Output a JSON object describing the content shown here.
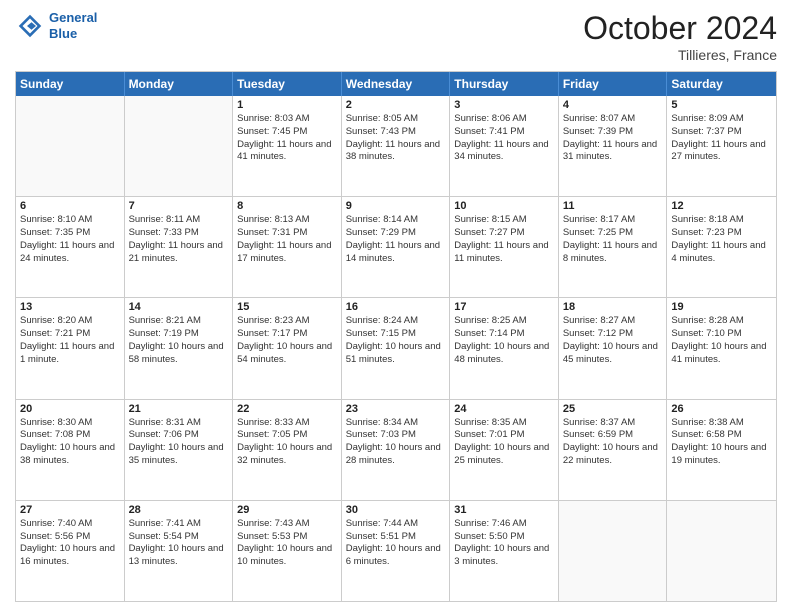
{
  "header": {
    "logo_line1": "General",
    "logo_line2": "Blue",
    "month": "October 2024",
    "location": "Tillieres, France"
  },
  "weekdays": [
    "Sunday",
    "Monday",
    "Tuesday",
    "Wednesday",
    "Thursday",
    "Friday",
    "Saturday"
  ],
  "rows": [
    [
      {
        "day": "",
        "empty": true
      },
      {
        "day": "",
        "empty": true
      },
      {
        "day": "1",
        "sunrise": "Sunrise: 8:03 AM",
        "sunset": "Sunset: 7:45 PM",
        "daylight": "Daylight: 11 hours and 41 minutes."
      },
      {
        "day": "2",
        "sunrise": "Sunrise: 8:05 AM",
        "sunset": "Sunset: 7:43 PM",
        "daylight": "Daylight: 11 hours and 38 minutes."
      },
      {
        "day": "3",
        "sunrise": "Sunrise: 8:06 AM",
        "sunset": "Sunset: 7:41 PM",
        "daylight": "Daylight: 11 hours and 34 minutes."
      },
      {
        "day": "4",
        "sunrise": "Sunrise: 8:07 AM",
        "sunset": "Sunset: 7:39 PM",
        "daylight": "Daylight: 11 hours and 31 minutes."
      },
      {
        "day": "5",
        "sunrise": "Sunrise: 8:09 AM",
        "sunset": "Sunset: 7:37 PM",
        "daylight": "Daylight: 11 hours and 27 minutes."
      }
    ],
    [
      {
        "day": "6",
        "sunrise": "Sunrise: 8:10 AM",
        "sunset": "Sunset: 7:35 PM",
        "daylight": "Daylight: 11 hours and 24 minutes."
      },
      {
        "day": "7",
        "sunrise": "Sunrise: 8:11 AM",
        "sunset": "Sunset: 7:33 PM",
        "daylight": "Daylight: 11 hours and 21 minutes."
      },
      {
        "day": "8",
        "sunrise": "Sunrise: 8:13 AM",
        "sunset": "Sunset: 7:31 PM",
        "daylight": "Daylight: 11 hours and 17 minutes."
      },
      {
        "day": "9",
        "sunrise": "Sunrise: 8:14 AM",
        "sunset": "Sunset: 7:29 PM",
        "daylight": "Daylight: 11 hours and 14 minutes."
      },
      {
        "day": "10",
        "sunrise": "Sunrise: 8:15 AM",
        "sunset": "Sunset: 7:27 PM",
        "daylight": "Daylight: 11 hours and 11 minutes."
      },
      {
        "day": "11",
        "sunrise": "Sunrise: 8:17 AM",
        "sunset": "Sunset: 7:25 PM",
        "daylight": "Daylight: 11 hours and 8 minutes."
      },
      {
        "day": "12",
        "sunrise": "Sunrise: 8:18 AM",
        "sunset": "Sunset: 7:23 PM",
        "daylight": "Daylight: 11 hours and 4 minutes."
      }
    ],
    [
      {
        "day": "13",
        "sunrise": "Sunrise: 8:20 AM",
        "sunset": "Sunset: 7:21 PM",
        "daylight": "Daylight: 11 hours and 1 minute."
      },
      {
        "day": "14",
        "sunrise": "Sunrise: 8:21 AM",
        "sunset": "Sunset: 7:19 PM",
        "daylight": "Daylight: 10 hours and 58 minutes."
      },
      {
        "day": "15",
        "sunrise": "Sunrise: 8:23 AM",
        "sunset": "Sunset: 7:17 PM",
        "daylight": "Daylight: 10 hours and 54 minutes."
      },
      {
        "day": "16",
        "sunrise": "Sunrise: 8:24 AM",
        "sunset": "Sunset: 7:15 PM",
        "daylight": "Daylight: 10 hours and 51 minutes."
      },
      {
        "day": "17",
        "sunrise": "Sunrise: 8:25 AM",
        "sunset": "Sunset: 7:14 PM",
        "daylight": "Daylight: 10 hours and 48 minutes."
      },
      {
        "day": "18",
        "sunrise": "Sunrise: 8:27 AM",
        "sunset": "Sunset: 7:12 PM",
        "daylight": "Daylight: 10 hours and 45 minutes."
      },
      {
        "day": "19",
        "sunrise": "Sunrise: 8:28 AM",
        "sunset": "Sunset: 7:10 PM",
        "daylight": "Daylight: 10 hours and 41 minutes."
      }
    ],
    [
      {
        "day": "20",
        "sunrise": "Sunrise: 8:30 AM",
        "sunset": "Sunset: 7:08 PM",
        "daylight": "Daylight: 10 hours and 38 minutes."
      },
      {
        "day": "21",
        "sunrise": "Sunrise: 8:31 AM",
        "sunset": "Sunset: 7:06 PM",
        "daylight": "Daylight: 10 hours and 35 minutes."
      },
      {
        "day": "22",
        "sunrise": "Sunrise: 8:33 AM",
        "sunset": "Sunset: 7:05 PM",
        "daylight": "Daylight: 10 hours and 32 minutes."
      },
      {
        "day": "23",
        "sunrise": "Sunrise: 8:34 AM",
        "sunset": "Sunset: 7:03 PM",
        "daylight": "Daylight: 10 hours and 28 minutes."
      },
      {
        "day": "24",
        "sunrise": "Sunrise: 8:35 AM",
        "sunset": "Sunset: 7:01 PM",
        "daylight": "Daylight: 10 hours and 25 minutes."
      },
      {
        "day": "25",
        "sunrise": "Sunrise: 8:37 AM",
        "sunset": "Sunset: 6:59 PM",
        "daylight": "Daylight: 10 hours and 22 minutes."
      },
      {
        "day": "26",
        "sunrise": "Sunrise: 8:38 AM",
        "sunset": "Sunset: 6:58 PM",
        "daylight": "Daylight: 10 hours and 19 minutes."
      }
    ],
    [
      {
        "day": "27",
        "sunrise": "Sunrise: 7:40 AM",
        "sunset": "Sunset: 5:56 PM",
        "daylight": "Daylight: 10 hours and 16 minutes."
      },
      {
        "day": "28",
        "sunrise": "Sunrise: 7:41 AM",
        "sunset": "Sunset: 5:54 PM",
        "daylight": "Daylight: 10 hours and 13 minutes."
      },
      {
        "day": "29",
        "sunrise": "Sunrise: 7:43 AM",
        "sunset": "Sunset: 5:53 PM",
        "daylight": "Daylight: 10 hours and 10 minutes."
      },
      {
        "day": "30",
        "sunrise": "Sunrise: 7:44 AM",
        "sunset": "Sunset: 5:51 PM",
        "daylight": "Daylight: 10 hours and 6 minutes."
      },
      {
        "day": "31",
        "sunrise": "Sunrise: 7:46 AM",
        "sunset": "Sunset: 5:50 PM",
        "daylight": "Daylight: 10 hours and 3 minutes."
      },
      {
        "day": "",
        "empty": true
      },
      {
        "day": "",
        "empty": true
      }
    ]
  ]
}
